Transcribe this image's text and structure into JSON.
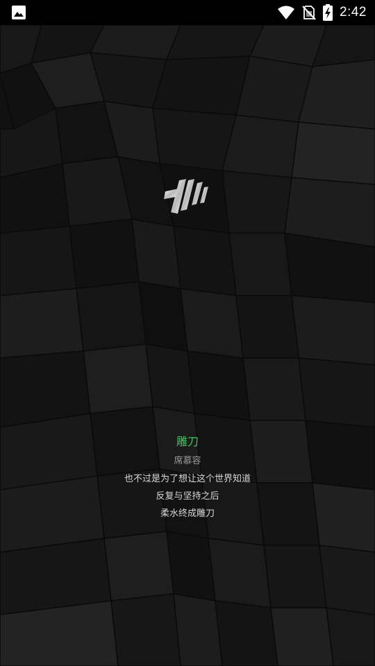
{
  "status_bar": {
    "time": "2:42",
    "left_icon": "image-icon",
    "right_icons": [
      "wifi-icon",
      "no-sim-icon",
      "battery-charging-icon"
    ]
  },
  "background": {
    "style": "dark low-poly mosaic",
    "base_color": "#141414"
  },
  "logo": {
    "icon": "app-logo-icon"
  },
  "quote": {
    "title": "雕刀",
    "author": "席慕容",
    "lines": [
      "也不过是为了想让这个世界知道",
      "反复与坚持之后",
      "柔水终成雕刀"
    ],
    "title_color": "#3cc85a"
  }
}
